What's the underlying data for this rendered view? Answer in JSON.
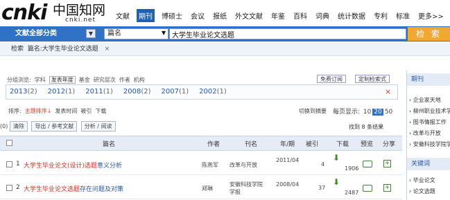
{
  "logo": {
    "mark": "cnki",
    "cn": "中国知网",
    "domain": "cnki.net"
  },
  "topnav": [
    "文献",
    "期刊",
    "博硕士",
    "会议",
    "报纸",
    "外文文献",
    "年鉴",
    "百科",
    "词典",
    "统计数据",
    "专利",
    "标准",
    "更多>>"
  ],
  "topnav_active": "期刊",
  "search": {
    "category": "文献全部分类",
    "field": "篇名",
    "query": "大学生毕业论文选题",
    "button": "检 索"
  },
  "crumb": {
    "label": "检索",
    "value": "篇名:大学生毕业论文选题",
    "close": "×"
  },
  "grouping": {
    "label": "分组浏览:",
    "items": [
      "学科",
      "发表年度",
      "基金",
      "研究层次",
      "作者",
      "机构"
    ],
    "active": "发表年度",
    "free_order": "免费订阅",
    "custom_format": "定制检索式"
  },
  "years": [
    {
      "year": "2013",
      "count": "(2)"
    },
    {
      "year": "2012",
      "count": "(1)"
    },
    {
      "year": "2011",
      "count": "(1)"
    },
    {
      "year": "2008",
      "count": "(2)"
    },
    {
      "year": "2007",
      "count": "(1)"
    },
    {
      "year": "2002",
      "count": "(1)"
    }
  ],
  "years_close": "×",
  "sort": {
    "label": "排序:",
    "items": [
      "主题排序↓",
      "发表时间",
      "被引",
      "下载"
    ],
    "active": "主题排序↓"
  },
  "switch_summary": "切换到摘要",
  "per_page": {
    "label": "每页显示:",
    "options": [
      "10",
      "20",
      "50"
    ],
    "selected": "20"
  },
  "actions": {
    "count": "(0)",
    "clear": "清除",
    "export": "导出 / 参考文献",
    "analyze": "分析 / 阅读"
  },
  "found": "找到 8 条结果",
  "table": {
    "headers": [
      "篇名",
      "作者",
      "刊名",
      "年/期",
      "被引",
      "下载",
      "预览",
      "分享"
    ],
    "rows": [
      {
        "num": "1",
        "title_hl": "大学生毕业论文(设计)选题",
        "title_rest": "意义分析",
        "author": "陈燕军",
        "journal": "改革与开放",
        "issue": "2011/04",
        "cited": "4",
        "downloads": "1906"
      },
      {
        "num": "2",
        "title_hl": "大学生毕业论文选题",
        "title_rest": "存在问题及对策",
        "author": "郑琳",
        "journal": "安徽科技学院学报",
        "issue": "2008/04",
        "cited": "37",
        "downloads": "2487"
      }
    ]
  },
  "sidebar": {
    "head1": "期刊",
    "items1": [
      "企业家天地",
      "柳州职业技术学院学报",
      "图书情报工作",
      "改革与开放",
      "安徽科技学院学报"
    ],
    "head2": "关键词",
    "items2": [
      "毕业论文",
      "论文选题"
    ]
  }
}
